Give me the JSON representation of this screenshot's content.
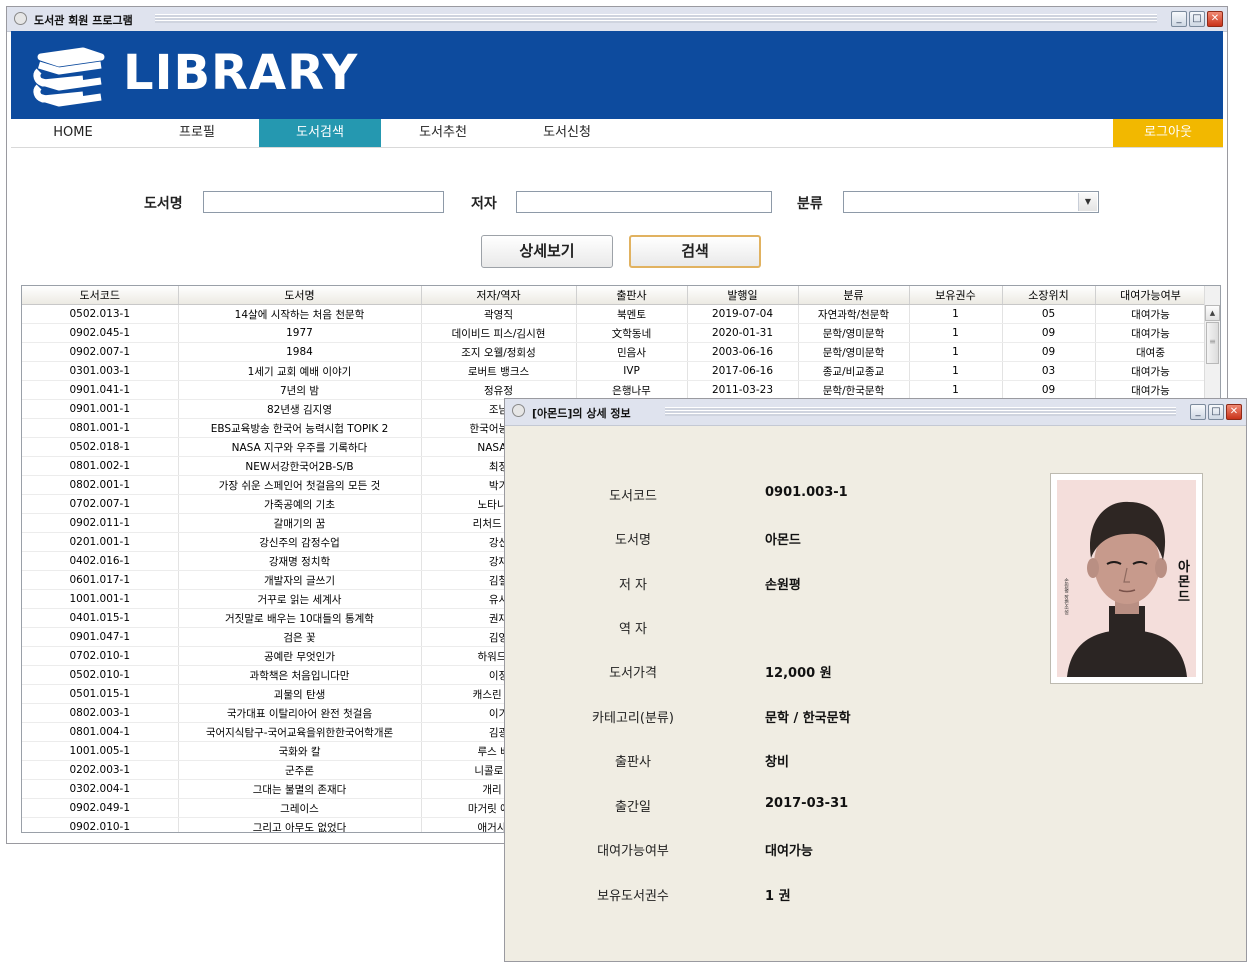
{
  "window": {
    "title": "도서관 회원 프로그램"
  },
  "banner": {
    "logo_text": "LIBRARY"
  },
  "nav": {
    "items": [
      "HOME",
      "프로필",
      "도서검색",
      "도서추천",
      "도서신청"
    ],
    "active": "도서검색",
    "logout": "로그아웃"
  },
  "search": {
    "title_label": "도서명",
    "title_value": "",
    "author_label": "저자",
    "author_value": "",
    "category_label": "분류",
    "category_value": "",
    "detail_button": "상세보기",
    "search_button": "검색"
  },
  "table": {
    "columns": [
      "도서코드",
      "도서명",
      "저자/역자",
      "출판사",
      "발행일",
      "분류",
      "보유권수",
      "소장위치",
      "대여가능여부"
    ],
    "rows": [
      [
        "0502.013-1",
        "14살에 시작하는 처음 천문학",
        "곽영직",
        "북멘토",
        "2019-07-04",
        "자연과학/천문학",
        "1",
        "05",
        "대여가능"
      ],
      [
        "0902.045-1",
        "1977",
        "데이비드 피스/김시현",
        "文학동네",
        "2020-01-31",
        "문학/영미문학",
        "1",
        "09",
        "대여가능"
      ],
      [
        "0902.007-1",
        "1984",
        "조지 오웰/정회성",
        "민음사",
        "2003-06-16",
        "문학/영미문학",
        "1",
        "09",
        "대여중"
      ],
      [
        "0301.003-1",
        "1세기 교회 예배 이야기",
        "로버트 뱅크스",
        "IVP",
        "2017-06-16",
        "종교/비교종교",
        "1",
        "03",
        "대여가능"
      ],
      [
        "0901.041-1",
        "7년의 밤",
        "정유정",
        "은행나무",
        "2011-03-23",
        "문학/한국문학",
        "1",
        "09",
        "대여가능"
      ],
      [
        "0901.001-1",
        "82년생 김지영",
        "조남",
        "",
        "",
        "",
        "",
        "",
        ""
      ],
      [
        "0801.001-1",
        "EBS교육방송 한국어 능력시험 TOPIK 2",
        "한국어능력시",
        "",
        "",
        "",
        "",
        "",
        ""
      ],
      [
        "0502.018-1",
        "NASA 지구와 우주를 기록하다",
        "NASA/박",
        "",
        "",
        "",
        "",
        "",
        ""
      ],
      [
        "0801.002-1",
        "NEW서강한국어2B-S/B",
        "최정",
        "",
        "",
        "",
        "",
        "",
        ""
      ],
      [
        "0802.001-1",
        "가장 쉬운 스페인어 첫걸음의 모든 것",
        "박기",
        "",
        "",
        "",
        "",
        "",
        ""
      ],
      [
        "0702.007-1",
        "가죽공예의 기초",
        "노타니 루",
        "",
        "",
        "",
        "",
        "",
        ""
      ],
      [
        "0902.011-1",
        "갈매기의 꿈",
        "리처드 바크",
        "",
        "",
        "",
        "",
        "",
        ""
      ],
      [
        "0201.001-1",
        "강신주의 감정수업",
        "강신",
        "",
        "",
        "",
        "",
        "",
        ""
      ],
      [
        "0402.016-1",
        "강재명 정치학",
        "강재",
        "",
        "",
        "",
        "",
        "",
        ""
      ],
      [
        "0601.017-1",
        "개발자의 글쓰기",
        "김철",
        "",
        "",
        "",
        "",
        "",
        ""
      ],
      [
        "1001.001-1",
        "거꾸로 읽는 세계사",
        "유시",
        "",
        "",
        "",
        "",
        "",
        ""
      ],
      [
        "0401.015-1",
        "거짓말로 배우는 10대들의 통계학",
        "권재",
        "",
        "",
        "",
        "",
        "",
        ""
      ],
      [
        "0901.047-1",
        "검은 꽃",
        "김영",
        "",
        "",
        "",
        "",
        "",
        ""
      ],
      [
        "0702.010-1",
        "공예란 무엇인가",
        "하워드 리",
        "",
        "",
        "",
        "",
        "",
        ""
      ],
      [
        "0502.010-1",
        "과학책은 처음입니다만",
        "이정",
        "",
        "",
        "",
        "",
        "",
        ""
      ],
      [
        "0501.015-1",
        "괴물의 탄생",
        "캐스린 하쿠",
        "",
        "",
        "",
        "",
        "",
        ""
      ],
      [
        "0802.003-1",
        "국가대표 이탈리아어 완전 첫걸음",
        "이기",
        "",
        "",
        "",
        "",
        "",
        ""
      ],
      [
        "0801.004-1",
        "국어지식탐구-국어교육을위한한국어학개론",
        "김광",
        "",
        "",
        "",
        "",
        "",
        ""
      ],
      [
        "1001.005-1",
        "국화와 칼",
        "루스 베네",
        "",
        "",
        "",
        "",
        "",
        ""
      ],
      [
        "0202.003-1",
        "군주론",
        "니콜로마키",
        "",
        "",
        "",
        "",
        "",
        ""
      ],
      [
        "0302.004-1",
        "그대는 불멸의 존재다",
        "개리 레",
        "",
        "",
        "",
        "",
        "",
        ""
      ],
      [
        "0902.049-1",
        "그레이스",
        "마거릿 애트우",
        "",
        "",
        "",
        "",
        "",
        ""
      ],
      [
        "0902.010-1",
        "그리고 아무도 없었다",
        "애거사 크",
        "",
        "",
        "",
        "",
        "",
        ""
      ]
    ]
  },
  "detail": {
    "title": "[아몬드]의 상세 정보",
    "fields": [
      {
        "label": "도서코드",
        "value": "0901.003-1"
      },
      {
        "label": "도서명",
        "value": "아몬드"
      },
      {
        "label": "저 자",
        "value": "손원평"
      },
      {
        "label": "역 자",
        "value": ""
      },
      {
        "label": "도서가격",
        "value": "12,000 원"
      },
      {
        "label": "카테고리(분류)",
        "value": "문학 / 한국문학"
      },
      {
        "label": "출판사",
        "value": "창비"
      },
      {
        "label": "출간일",
        "value": "2017-03-31"
      },
      {
        "label": "대여가능여부",
        "value": "대여가능"
      },
      {
        "label": "보유도서권수",
        "value": "1 권"
      }
    ],
    "cover_text": "아몬드",
    "cover_author": "손원평 장편소설"
  },
  "colors": {
    "banner": "#0d4b9e",
    "nav_active": "#2598b0",
    "logout": "#f2b800",
    "detail_bg": "#f0ede3"
  }
}
